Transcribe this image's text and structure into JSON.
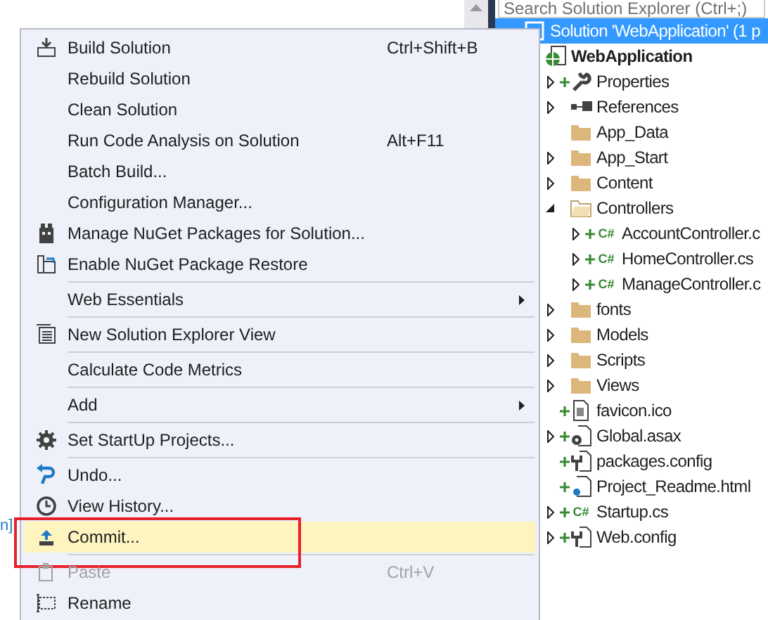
{
  "editor": {
    "code_fragment": "n]"
  },
  "context_menu": {
    "items": [
      {
        "kind": "build",
        "label": "Build Solution",
        "shortcut": "Ctrl+Shift+B"
      },
      {
        "kind": "plain",
        "label": "Rebuild Solution"
      },
      {
        "kind": "plain",
        "label": "Clean Solution"
      },
      {
        "kind": "plain",
        "label": "Run Code Analysis on Solution",
        "shortcut": "Alt+F11"
      },
      {
        "kind": "plain",
        "label": "Batch Build..."
      },
      {
        "kind": "plain",
        "label": "Configuration Manager..."
      },
      {
        "kind": "package",
        "label": "Manage NuGet Packages for Solution..."
      },
      {
        "kind": "restore",
        "label": "Enable NuGet Package Restore"
      },
      {
        "kind": "separator"
      },
      {
        "kind": "plain",
        "label": "Web Essentials",
        "submenu": true
      },
      {
        "kind": "separator"
      },
      {
        "kind": "explorer",
        "label": "New Solution Explorer View"
      },
      {
        "kind": "separator"
      },
      {
        "kind": "plain",
        "label": "Calculate Code Metrics"
      },
      {
        "kind": "separator"
      },
      {
        "kind": "plain",
        "label": "Add",
        "submenu": true
      },
      {
        "kind": "separator"
      },
      {
        "kind": "gear",
        "label": "Set StartUp Projects..."
      },
      {
        "kind": "separator"
      },
      {
        "kind": "undo",
        "label": "Undo..."
      },
      {
        "kind": "history",
        "label": "View History..."
      },
      {
        "kind": "commit",
        "label": "Commit...",
        "highlighted": true,
        "outlined": true
      },
      {
        "kind": "separator"
      },
      {
        "kind": "paste",
        "label": "Paste",
        "shortcut": "Ctrl+V",
        "disabled": true
      },
      {
        "kind": "rename",
        "label": "Rename"
      }
    ]
  },
  "solution_explorer": {
    "search": {
      "placeholder": "Search Solution Explorer (Ctrl+;)"
    },
    "tree": [
      {
        "kind": "solution",
        "label": "Solution 'WebApplication' (1 p",
        "selected": true,
        "children": [
          {
            "kind": "project",
            "label": "WebApplication",
            "bold": true,
            "selected": false,
            "children": [
              {
                "kind": "wrench",
                "label": "Properties",
                "pending_add": true,
                "expanded": false,
                "selected": false
              },
              {
                "kind": "references",
                "label": "References",
                "expanded": false,
                "selected": false
              },
              {
                "kind": "folder",
                "label": "App_Data",
                "selected": false
              },
              {
                "kind": "folder",
                "label": "App_Start",
                "expanded": false,
                "selected": false
              },
              {
                "kind": "folder",
                "label": "Content",
                "expanded": false,
                "selected": false
              },
              {
                "kind": "openfolder",
                "label": "Controllers",
                "expanded": true,
                "selected": false,
                "children": [
                  {
                    "kind": "code",
                    "badge": "C#",
                    "label": "AccountController.c",
                    "pending_add": true,
                    "expanded": false,
                    "selected": false
                  },
                  {
                    "kind": "code",
                    "badge": "C#",
                    "label": "HomeController.cs",
                    "pending_add": true,
                    "expanded": false,
                    "selected": false
                  },
                  {
                    "kind": "code",
                    "badge": "C#",
                    "label": "ManageController.c",
                    "pending_add": true,
                    "expanded": false,
                    "selected": false
                  }
                ]
              },
              {
                "kind": "folder",
                "label": "fonts",
                "expanded": false,
                "selected": false
              },
              {
                "kind": "folder",
                "label": "Models",
                "expanded": false,
                "selected": false
              },
              {
                "kind": "folder",
                "label": "Scripts",
                "expanded": false,
                "selected": false
              },
              {
                "kind": "folder",
                "label": "Views",
                "expanded": false,
                "selected": false
              },
              {
                "kind": "image",
                "label": "favicon.ico",
                "pending_add": true,
                "selected": false
              },
              {
                "kind": "gearfile",
                "label": "Global.asax",
                "pending_add": true,
                "expanded": false,
                "selected": false
              },
              {
                "kind": "config",
                "label": "packages.config",
                "pending_add": true,
                "selected": false
              },
              {
                "kind": "html",
                "label": "Project_Readme.html",
                "pending_add": true,
                "selected": false
              },
              {
                "kind": "code",
                "badge": "C#",
                "label": "Startup.cs",
                "pending_add": true,
                "expanded": false,
                "selected": false
              },
              {
                "kind": "config",
                "label": "Web.config",
                "pending_add": true,
                "expanded": false,
                "selected": false
              }
            ]
          }
        ]
      }
    ]
  }
}
